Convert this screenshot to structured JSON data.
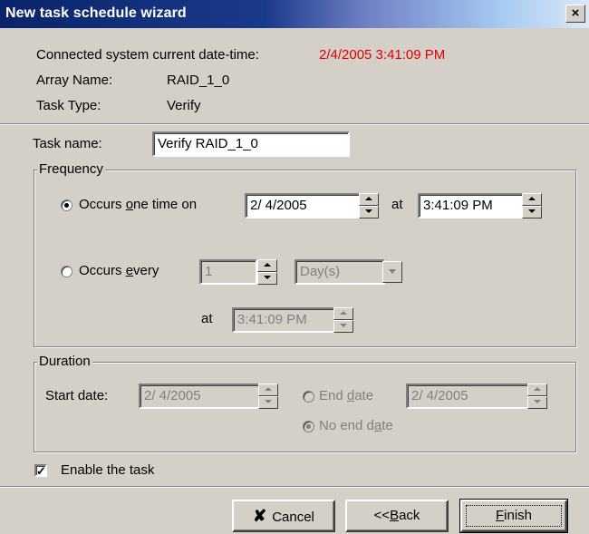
{
  "window": {
    "title": "New task schedule wizard",
    "close_label": "×"
  },
  "info": {
    "datetime_label": "Connected system current date-time:",
    "datetime_value": "2/4/2005 3:41:09 PM",
    "array_label": "Array Name:",
    "array_value": "RAID_1_0",
    "type_label": "Task Type:",
    "type_value": "Verify"
  },
  "task_name": {
    "label": "Task name:",
    "value": "Verify RAID_1_0"
  },
  "frequency": {
    "title": "Frequency",
    "once_label_pre": "Occurs ",
    "once_label_ul": "o",
    "once_label_post": "ne time on",
    "once_selected": true,
    "once_date": "2/  4/2005",
    "at_label": "at",
    "once_time": "3:41:09 PM",
    "every_label_pre": "Occurs ",
    "every_label_ul": "e",
    "every_label_post": "very",
    "every_selected": false,
    "every_count": "1",
    "every_unit": "Day(s)",
    "every_at_label": "at",
    "every_time": "3:41:09 PM"
  },
  "duration": {
    "title": "Duration",
    "start_label": "Start date:",
    "start_value": "2/  4/2005",
    "end_label_pre": "End ",
    "end_label_ul": "d",
    "end_label_post": "ate",
    "end_selected": false,
    "end_value": "2/  4/2005",
    "noend_label_pre": "No end d",
    "noend_label_ul": "a",
    "noend_label_post": "te",
    "noend_selected": true
  },
  "enable": {
    "label": "Enable the task",
    "checked": true,
    "check_mark": "✓"
  },
  "buttons": {
    "cancel": "Cancel",
    "back_pre": "<<",
    "back_ul": "B",
    "back_post": "ack",
    "finish_ul": "F",
    "finish_post": "inish"
  },
  "icons": {
    "cancel_icon": "✘"
  },
  "colors": {
    "datetime_value": "#e00000",
    "titlebar": "#0a246a",
    "cancel_icon": "#000000"
  }
}
